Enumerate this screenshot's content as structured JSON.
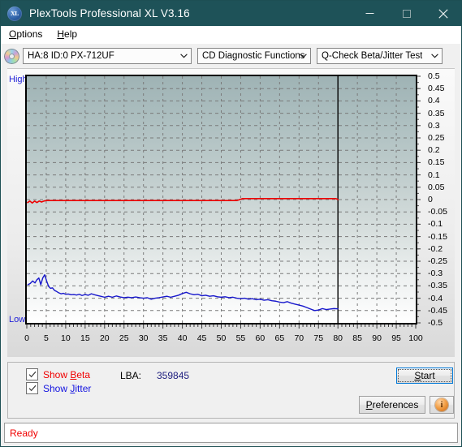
{
  "window": {
    "title": "PlexTools Professional XL V3.16",
    "app_icon": "xl-disc-icon",
    "minimize": "minimize-icon",
    "maximize": "maximize-icon",
    "close": "close-icon"
  },
  "menu": {
    "items": [
      {
        "label": "Options",
        "accel": "O"
      },
      {
        "label": "Help",
        "accel": "H"
      }
    ]
  },
  "toolbar": {
    "drive_combo": "HA:8 ID:0  PX-712UF",
    "function_combo": "CD Diagnostic Functions",
    "test_combo": "Q-Check Beta/Jitter Test"
  },
  "chart_data": {
    "type": "line",
    "title": "",
    "xlabel": "",
    "ylabel": "",
    "high_label": "High",
    "low_label": "Low",
    "xlim": [
      0,
      100
    ],
    "ylim": [
      -0.5,
      0.5
    ],
    "xticks": [
      0,
      5,
      10,
      15,
      20,
      25,
      30,
      35,
      40,
      45,
      50,
      55,
      60,
      65,
      70,
      75,
      80,
      85,
      90,
      95,
      100
    ],
    "yticks": [
      0.5,
      0.45,
      0.4,
      0.35,
      0.3,
      0.25,
      0.2,
      0.15,
      0.1,
      0.05,
      0,
      -0.05,
      -0.1,
      -0.15,
      -0.2,
      -0.25,
      -0.3,
      -0.35,
      -0.4,
      -0.45,
      -0.5
    ],
    "grid": true,
    "legend": [
      "Beta",
      "Jitter"
    ],
    "marker_x": 80,
    "colors": {
      "beta": "#ee0000",
      "jitter": "#1717cc"
    },
    "series": [
      {
        "name": "Beta",
        "color": "#ee0000",
        "x": [
          0.2,
          0.8,
          1.4,
          2.0,
          2.6,
          3.2,
          3.8,
          4.4,
          5.0,
          6.0,
          7.0,
          8.0,
          9.0,
          10.0,
          12.0,
          14.0,
          16.0,
          18.0,
          20.0,
          24.0,
          28.0,
          32.0,
          36.0,
          40.0,
          44.0,
          48.0,
          52.0,
          54.0,
          55.5,
          56.5,
          57.5,
          59.0,
          62.0,
          66.0,
          70.0,
          74.0,
          78.0,
          79.5,
          80.0
        ],
        "y": [
          -0.012,
          -0.006,
          -0.014,
          -0.006,
          -0.012,
          -0.006,
          -0.01,
          -0.006,
          -0.004,
          -0.004,
          -0.004,
          -0.004,
          -0.004,
          -0.004,
          -0.004,
          -0.004,
          -0.004,
          -0.004,
          -0.004,
          -0.004,
          -0.004,
          -0.004,
          -0.004,
          -0.004,
          -0.004,
          -0.004,
          -0.004,
          -0.004,
          0.004,
          0.004,
          0.004,
          0.004,
          0.004,
          0.004,
          0.004,
          0.004,
          0.004,
          0.004,
          0.0
        ]
      },
      {
        "name": "Jitter",
        "color": "#1717cc",
        "x": [
          0.3,
          0.9,
          1.5,
          2.1,
          2.6,
          3.1,
          3.6,
          4.1,
          4.6,
          5.1,
          5.6,
          6.1,
          6.6,
          7.1,
          7.6,
          8.2,
          8.8,
          9.4,
          10.0,
          10.7,
          11.4,
          12.1,
          12.8,
          13.5,
          14.2,
          15.0,
          15.8,
          16.6,
          17.4,
          18.2,
          19.0,
          20.0,
          21.0,
          22.0,
          23.0,
          24.0,
          25.0,
          26.0,
          27.0,
          28.0,
          29.0,
          30.0,
          31.0,
          32.0,
          33.0,
          34.0,
          35.0,
          36.0,
          37.0,
          38.0,
          39.0,
          40.0,
          41.0,
          42.0,
          43.0,
          44.0,
          45.0,
          46.0,
          47.0,
          48.0,
          49.0,
          50.0,
          51.0,
          52.0,
          53.0,
          54.0,
          55.0,
          56.0,
          57.0,
          58.0,
          59.0,
          60.0,
          61.0,
          62.0,
          63.0,
          64.0,
          65.0,
          66.0,
          67.0,
          68.0,
          69.0,
          70.0,
          71.0,
          72.0,
          73.0,
          74.0,
          75.0,
          76.0,
          77.0,
          78.0,
          79.0,
          80.0
        ],
        "y": [
          -0.345,
          -0.34,
          -0.33,
          -0.338,
          -0.325,
          -0.318,
          -0.345,
          -0.318,
          -0.305,
          -0.33,
          -0.352,
          -0.36,
          -0.358,
          -0.368,
          -0.372,
          -0.378,
          -0.382,
          -0.38,
          -0.384,
          -0.383,
          -0.386,
          -0.385,
          -0.387,
          -0.384,
          -0.389,
          -0.385,
          -0.388,
          -0.382,
          -0.386,
          -0.389,
          -0.392,
          -0.396,
          -0.392,
          -0.396,
          -0.391,
          -0.395,
          -0.398,
          -0.396,
          -0.398,
          -0.395,
          -0.398,
          -0.4,
          -0.398,
          -0.404,
          -0.4,
          -0.398,
          -0.395,
          -0.392,
          -0.396,
          -0.392,
          -0.388,
          -0.381,
          -0.376,
          -0.382,
          -0.386,
          -0.384,
          -0.39,
          -0.388,
          -0.392,
          -0.39,
          -0.394,
          -0.396,
          -0.394,
          -0.398,
          -0.396,
          -0.4,
          -0.402,
          -0.4,
          -0.404,
          -0.402,
          -0.406,
          -0.404,
          -0.408,
          -0.406,
          -0.41,
          -0.412,
          -0.416,
          -0.418,
          -0.414,
          -0.42,
          -0.424,
          -0.428,
          -0.432,
          -0.438,
          -0.444,
          -0.45,
          -0.448,
          -0.442,
          -0.446,
          -0.444,
          -0.442,
          -0.443
        ]
      }
    ]
  },
  "controls": {
    "show_beta": {
      "label_prefix": "Show ",
      "label_accel": "B",
      "label_suffix": "eta",
      "checked": true
    },
    "show_jitter": {
      "label_prefix": "Show ",
      "label_accel": "J",
      "label_suffix": "itter",
      "checked": true
    },
    "lba_label": "LBA:",
    "lba_value": "359845",
    "start_button": {
      "prefix": "",
      "accel": "S",
      "suffix": "tart"
    },
    "preferences_button": {
      "prefix": "",
      "accel": "P",
      "suffix": "references"
    },
    "info_button": "info-icon"
  },
  "status": {
    "text": "Ready"
  }
}
